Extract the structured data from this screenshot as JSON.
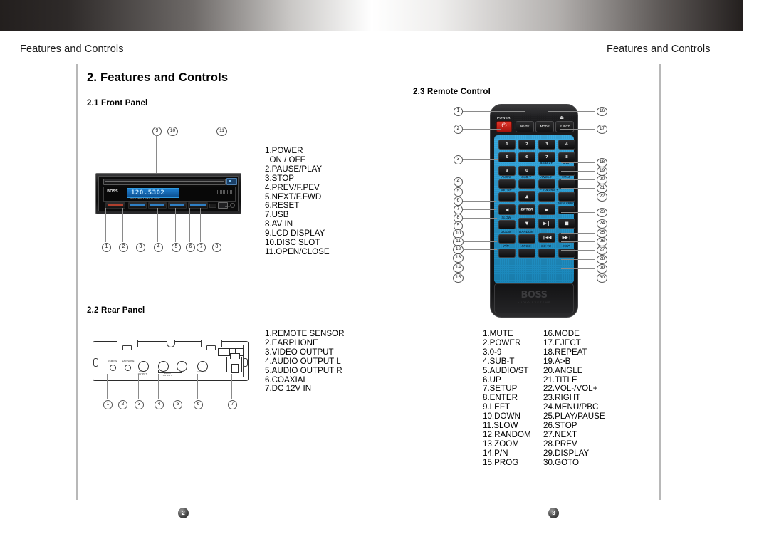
{
  "document": {
    "running_head_left": "Features and Controls",
    "running_head_right": "Features and Controls",
    "chapter_heading": "2.  Features and Controls",
    "page_number_left": "2",
    "page_number_right": "3"
  },
  "sections": {
    "front_panel": {
      "number_title": "2.1  Front Panel",
      "legend": "1.POWER\n  ON / OFF\n2.PAUSE/PLAY\n3.STOP\n4.PREV/F.PEV\n5.NEXT/F.FWD\n6.RESET\n7.USB\n8.AV IN\n9.LCD DISPLAY\n10.DISC SLOT\n11.OPEN/CLOSE",
      "callouts_bottom": [
        "1",
        "2",
        "3",
        "4",
        "5",
        "6",
        "7",
        "8"
      ],
      "callouts_top": [
        "9",
        "10",
        "11"
      ],
      "device": {
        "brand": "BOSS",
        "display_text": "120.5302",
        "display_subtext": "MULTI MEDIA DISC PLAYER",
        "av_label": "AV IN"
      }
    },
    "rear_panel": {
      "number_title": "2.2  Rear Panel",
      "legend": "1.REMOTE SENSOR\n2.EARPHONE\n3.VIDEO OUTPUT\n4.AUDIO OUTPUT L\n5.AUDIO OUTPUT R\n6.COAXIAL\n7.DC 12V IN",
      "callouts": [
        "1",
        "2",
        "3",
        "4",
        "5",
        "6",
        "7"
      ],
      "jack_labels": {
        "remote": "REMOTE",
        "earphone": "EARPHONE",
        "video": "VIDEO\nOUTPUT",
        "audio": "AUDIO\nOUTPUT",
        "coaxial": "COAXIAL",
        "terminal_1": "+12V",
        "terminal_2": "GND",
        "terminal_3": "REMOTE",
        "terminal_4": "ACC"
      }
    },
    "remote_control": {
      "number_title": "2.3  Remote Control",
      "legend_left": "1.MUTE\n2.POWER\n3.0-9\n4.SUB-T\n5.AUDIO/ST\n6.UP\n7.SETUP\n8.ENTER\n9.LEFT\n10.DOWN\n11.SLOW\n12.RANDOM\n13.ZOOM\n14.P/N\n15.PROG",
      "legend_right": "16.MODE\n17.EJECT\n18.REPEAT\n19.A>B\n20.ANGLE\n21.TITLE\n22.VOL-/VOL+\n23.RIGHT\n24.MENU/PBC\n25.PLAY/PAUSE\n26.STOP\n27.NEXT\n28.PREV\n29.DISPLAY\n30.GOTO",
      "callouts_left": [
        "1",
        "2",
        "3",
        "4",
        "5",
        "6",
        "7",
        "8",
        "9",
        "10",
        "11",
        "12",
        "13",
        "14",
        "15"
      ],
      "callouts_right": [
        "16",
        "17",
        "18",
        "19",
        "20",
        "21",
        "22",
        "23",
        "24",
        "25",
        "26",
        "27",
        "28",
        "29",
        "30"
      ],
      "device": {
        "power_label": "POWER",
        "eject_icon": "⏏",
        "top_buttons": [
          "MUTE",
          "MODE",
          "EJECT"
        ],
        "numeric_keys": [
          "1",
          "2",
          "3",
          "4",
          "5",
          "6",
          "7",
          "8",
          "9",
          "0"
        ],
        "function_labels": [
          "REPEAT",
          "A>B",
          "AUDIO",
          "SUB-T",
          "ANGLE",
          "TITLE",
          "SETUP",
          "VOLUME",
          "MENU/PBC",
          "SLOW",
          "ZOOM",
          "RANDOM",
          "P/N",
          "PROG",
          "GO TO",
          "DISP",
          "ENTER"
        ],
        "volume_label": "− VOLUME +",
        "brand": "BOSS",
        "brand_sub": "AUDIO SYSTEMS"
      }
    }
  },
  "colors": {
    "remote_keypad_blue": "#1FA0DD",
    "power_button_red": "#D32A20",
    "lcd_blue": "#1E7FD0",
    "rule_gray": "#B8B8B8"
  }
}
